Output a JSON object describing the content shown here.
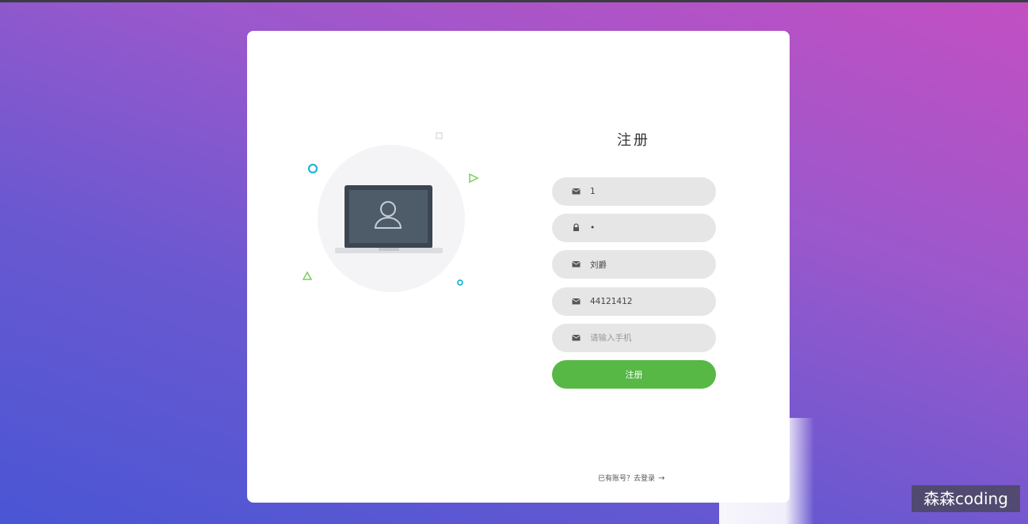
{
  "form": {
    "title": "注册",
    "fields": [
      {
        "icon": "envelope-icon",
        "value": "1",
        "placeholder": ""
      },
      {
        "icon": "lock-icon",
        "value": "•",
        "placeholder": ""
      },
      {
        "icon": "envelope-icon",
        "value": "刘爵",
        "placeholder": ""
      },
      {
        "icon": "envelope-icon",
        "value": "44121412",
        "placeholder": ""
      },
      {
        "icon": "envelope-icon",
        "value": "",
        "placeholder": "请输入手机"
      }
    ],
    "submit_label": "注册",
    "login_link": "已有账号？去登录",
    "login_arrow": "→"
  },
  "colors": {
    "accent_green": "#57b846",
    "field_bg": "#e6e6e6",
    "deco_cyan": "#1fb6d6",
    "deco_green": "#7ccf5a"
  },
  "watermark": "森森coding"
}
